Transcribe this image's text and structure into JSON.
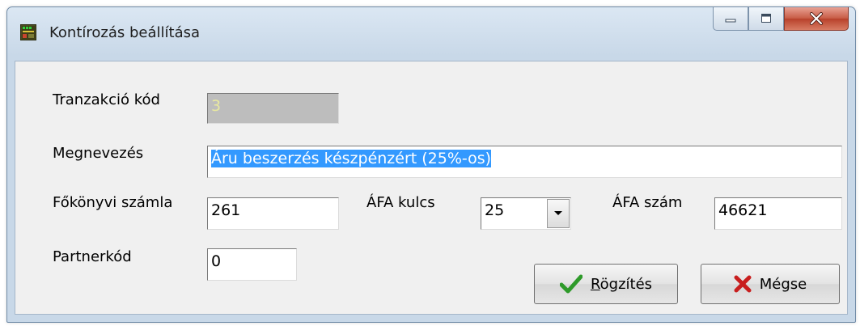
{
  "window": {
    "title": "Kontírozás beállítása",
    "icon": "app-grid-icon"
  },
  "form": {
    "tranzakcio_kod": {
      "label": "Tranzakció kód",
      "value": "3"
    },
    "megnevezes": {
      "label": "Megnevezés",
      "value": "Áru beszerzés készpénzért (25%-os)"
    },
    "fokonyvi_szamla": {
      "label": "Főkönyvi számla",
      "value": "261"
    },
    "afa_kulcs": {
      "label": "ÁFA kulcs",
      "value": "25"
    },
    "afa_szam": {
      "label": "ÁFA szám",
      "value": "46621"
    },
    "partnerkod": {
      "label": "Partnerkód",
      "value": "0"
    }
  },
  "buttons": {
    "rogzites": {
      "underlined": "R",
      "rest": "ögzítés",
      "icon": "checkmark-icon"
    },
    "megse": {
      "label": "Mégse",
      "icon": "cross-icon"
    }
  },
  "colors": {
    "selection": "#3399ff",
    "checkmark": "#2e9a2a",
    "cross": "#c81e1e"
  }
}
